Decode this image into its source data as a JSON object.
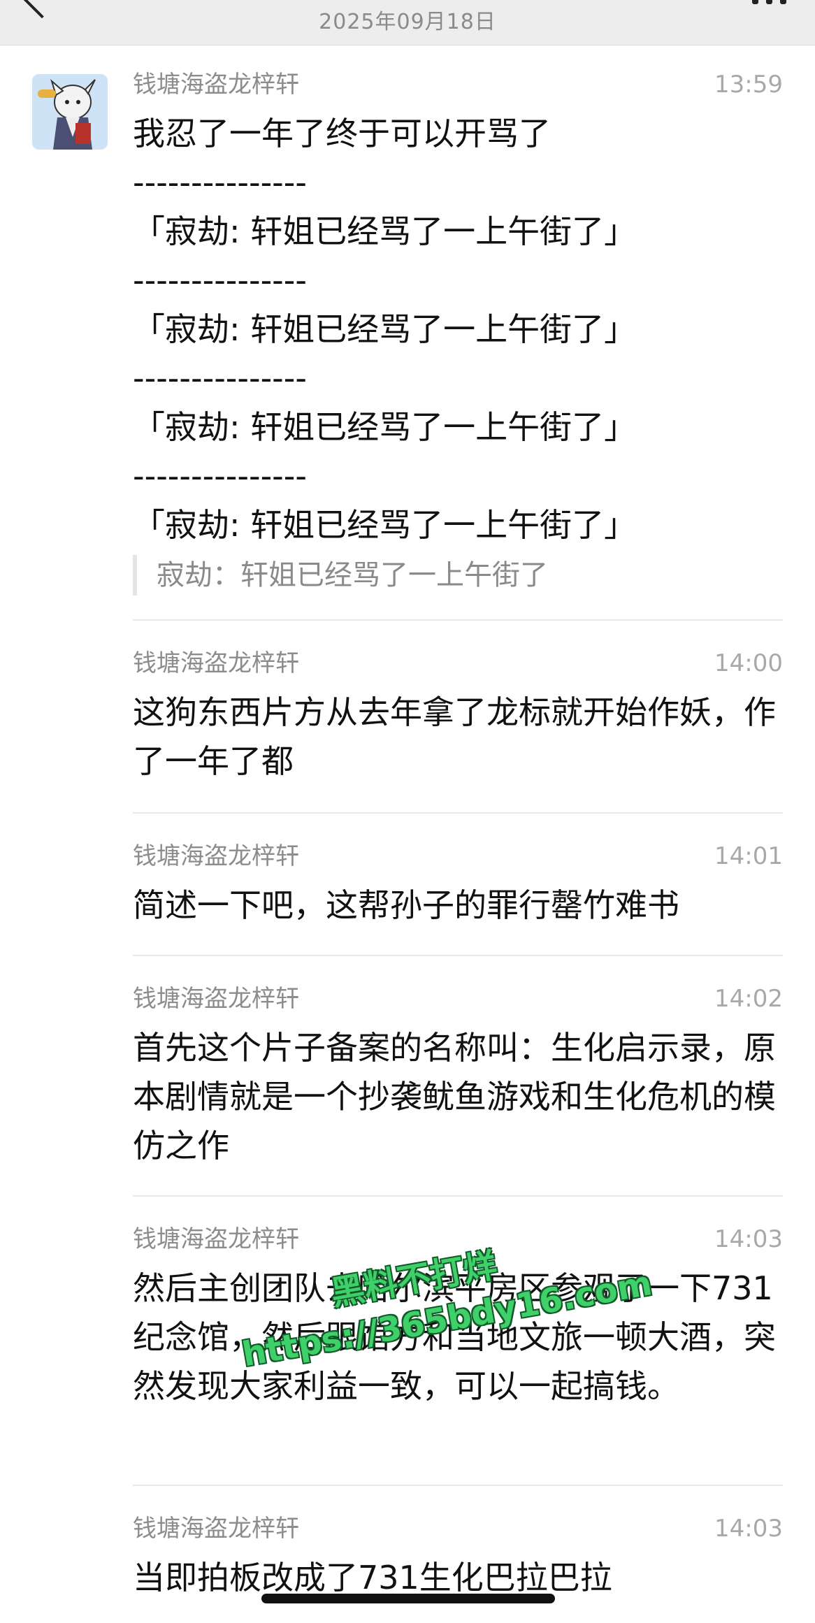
{
  "header": {
    "date": "2025年09月18日"
  },
  "messages": [
    {
      "sender": "钱塘海盗龙梓轩",
      "time": "13:59",
      "text": "我忍了一年了终于可以开骂了\n---------------\n「寂劫: 轩姐已经骂了一上午街了」\n---------------\n「寂劫: 轩姐已经骂了一上午街了」\n---------------\n「寂劫: 轩姐已经骂了一上午街了」\n---------------\n「寂劫: 轩姐已经骂了一上午街了」",
      "quote": "寂劫：轩姐已经骂了一上午街了"
    },
    {
      "sender": "钱塘海盗龙梓轩",
      "time": "14:00",
      "text": "这狗东西片方从去年拿了龙标就开始作妖，作了一年了都"
    },
    {
      "sender": "钱塘海盗龙梓轩",
      "time": "14:01",
      "text": "简述一下吧，这帮孙子的罪行罄竹难书"
    },
    {
      "sender": "钱塘海盗龙梓轩",
      "time": "14:02",
      "text": "首先这个片子备案的名称叫：生化启示录，原本剧情就是一个抄袭鱿鱼游戏和生化危机的模仿之作"
    },
    {
      "sender": "钱塘海盗龙梓轩",
      "time": "14:03",
      "text": "然后主创团队去哈尔滨平房区参观了一下731纪念馆，然后跟馆方和当地文旅一顿大酒，突然发现大家利益一致，可以一起搞钱。"
    },
    {
      "sender": "钱塘海盗龙梓轩",
      "time": "14:03",
      "text": "当即拍板改成了731生化巴拉巴拉"
    }
  ],
  "watermark": {
    "line1": "黑料不打烊",
    "line2": "https://365bdy16.com"
  },
  "icons": {
    "back": "back-chevron-icon",
    "more": "more-dots-icon"
  }
}
